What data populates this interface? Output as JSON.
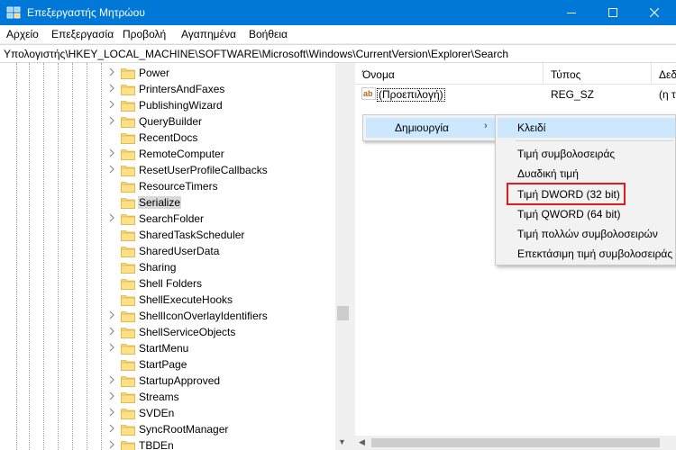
{
  "window": {
    "title": "Επεξεργαστής Μητρώου",
    "icons": [
      "regedit-icon",
      "minimize-icon",
      "maximize-icon",
      "close-icon"
    ]
  },
  "menu": [
    "Αρχείο",
    "Επεξεργασία",
    "Προβολή",
    "Αγαπημένα",
    "Βοήθεια"
  ],
  "address": "Υπολογιστής\\HKEY_LOCAL_MACHINE\\SOFTWARE\\Microsoft\\Windows\\CurrentVersion\\Explorer\\Search",
  "tree": {
    "items": [
      {
        "label": "Power",
        "expandable": true
      },
      {
        "label": "PrintersAndFaxes",
        "expandable": true
      },
      {
        "label": "PublishingWizard",
        "expandable": true
      },
      {
        "label": "QueryBuilder",
        "expandable": true
      },
      {
        "label": "RecentDocs",
        "expandable": false
      },
      {
        "label": "RemoteComputer",
        "expandable": true
      },
      {
        "label": "ResetUserProfileCallbacks",
        "expandable": true
      },
      {
        "label": "ResourceTimers",
        "expandable": false
      },
      {
        "label": "Serialize",
        "expandable": false,
        "selected": true
      },
      {
        "label": "SearchFolder",
        "expandable": true
      },
      {
        "label": "SharedTaskScheduler",
        "expandable": false
      },
      {
        "label": "SharedUserData",
        "expandable": false
      },
      {
        "label": "Sharing",
        "expandable": false
      },
      {
        "label": "Shell Folders",
        "expandable": false
      },
      {
        "label": "ShellExecuteHooks",
        "expandable": false
      },
      {
        "label": "ShellIconOverlayIdentifiers",
        "expandable": true
      },
      {
        "label": "ShellServiceObjects",
        "expandable": true
      },
      {
        "label": "StartMenu",
        "expandable": true
      },
      {
        "label": "StartPage",
        "expandable": false
      },
      {
        "label": "StartupApproved",
        "expandable": true
      },
      {
        "label": "Streams",
        "expandable": true
      },
      {
        "label": "SVDEn",
        "expandable": true
      },
      {
        "label": "SyncRootManager",
        "expandable": true
      },
      {
        "label": "TBDEn",
        "expandable": true
      }
    ]
  },
  "list": {
    "columns": [
      "Όνομα",
      "Τύπος",
      "Δεδ"
    ],
    "rows": [
      {
        "icon": "ab",
        "name": "(Προεπιλογή)",
        "type": "REG_SZ",
        "data": "(η τ"
      }
    ]
  },
  "context_menu": {
    "new_label": "Δημιουργία",
    "submenu_arrow": "›"
  },
  "submenu": {
    "key": "Κλειδί",
    "items": [
      "Τιμή συμβολοσειράς",
      "Δυαδική τιμή",
      "Τιμή DWORD (32 bit)",
      "Τιμή QWORD (64 bit)",
      "Τιμή πολλών συμβολοσειρών",
      "Επεκτάσιμη τιμή συμβολοσειράς"
    ]
  },
  "colors": {
    "titlebar": "#0078d7",
    "menu_highlight": "#cce8ff",
    "annotation_border": "#e11c1c",
    "folder": "#f8d775"
  }
}
